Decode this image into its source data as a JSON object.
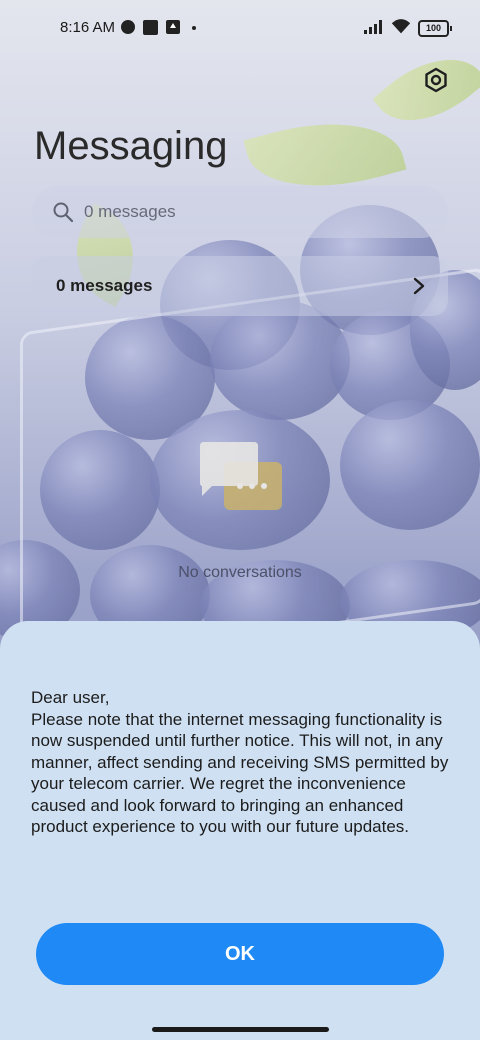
{
  "status_bar": {
    "time": "8:16 AM",
    "battery": "100"
  },
  "header": {
    "title": "Messaging",
    "settings_icon": "gear-icon"
  },
  "search": {
    "placeholder": "0 messages"
  },
  "banner": {
    "label": "0 messages"
  },
  "empty_state": {
    "text": "No conversations"
  },
  "dialog": {
    "message": "Dear user,\nPlease note that the internet messaging functionality is now suspended until further notice. This will not, in any manner, affect sending and receiving SMS permitted by your telecom carrier. We regret the inconvenience caused and look forward to bringing an enhanced product experience to you with our future updates.",
    "ok_label": "OK"
  },
  "colors": {
    "accent": "#1f8af5",
    "sheet_bg": "#cfe0f2"
  }
}
